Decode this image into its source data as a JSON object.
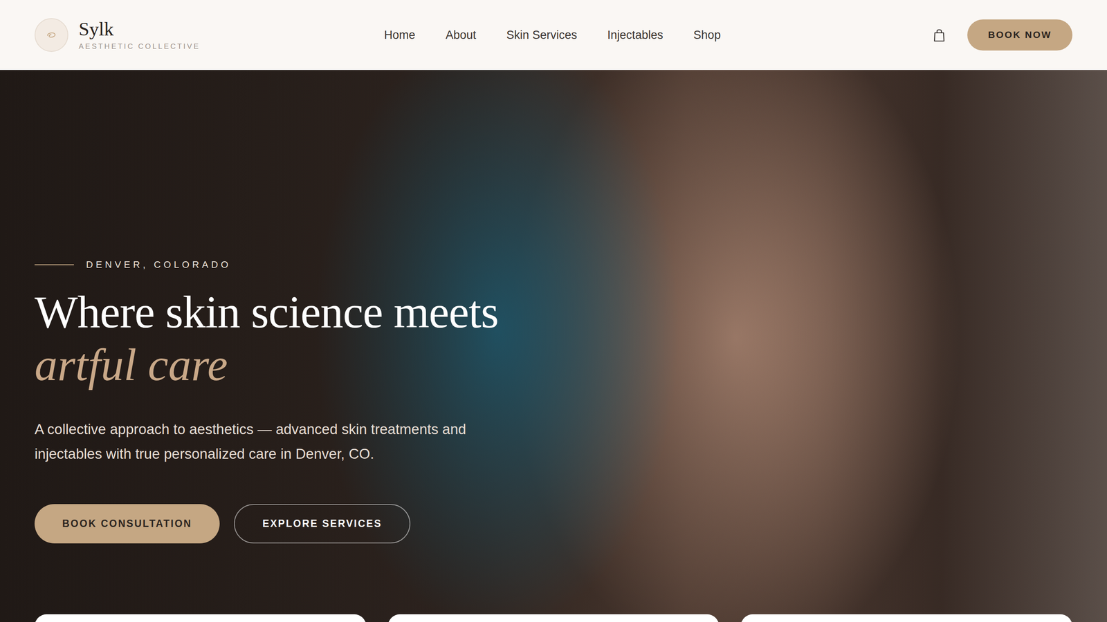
{
  "brand": {
    "name": "Sylk",
    "tagline": "AESTHETIC COLLECTIVE"
  },
  "nav": {
    "items": [
      {
        "label": "Home"
      },
      {
        "label": "About"
      },
      {
        "label": "Skin Services"
      },
      {
        "label": "Injectables"
      },
      {
        "label": "Shop"
      }
    ],
    "cta": "BOOK NOW"
  },
  "hero": {
    "eyebrow": "DENVER, COLORADO",
    "title": "Where skin science meets",
    "title_accent": "artful care",
    "description": "A collective approach to aesthetics — advanced skin treatments and injectables with true personalized care in Denver, CO.",
    "buttons": [
      {
        "label": "BOOK CONSULTATION",
        "kind": "primary"
      },
      {
        "label": "EXPLORE SERVICES",
        "kind": "outline"
      }
    ]
  },
  "cards": [
    {},
    {},
    {}
  ]
}
